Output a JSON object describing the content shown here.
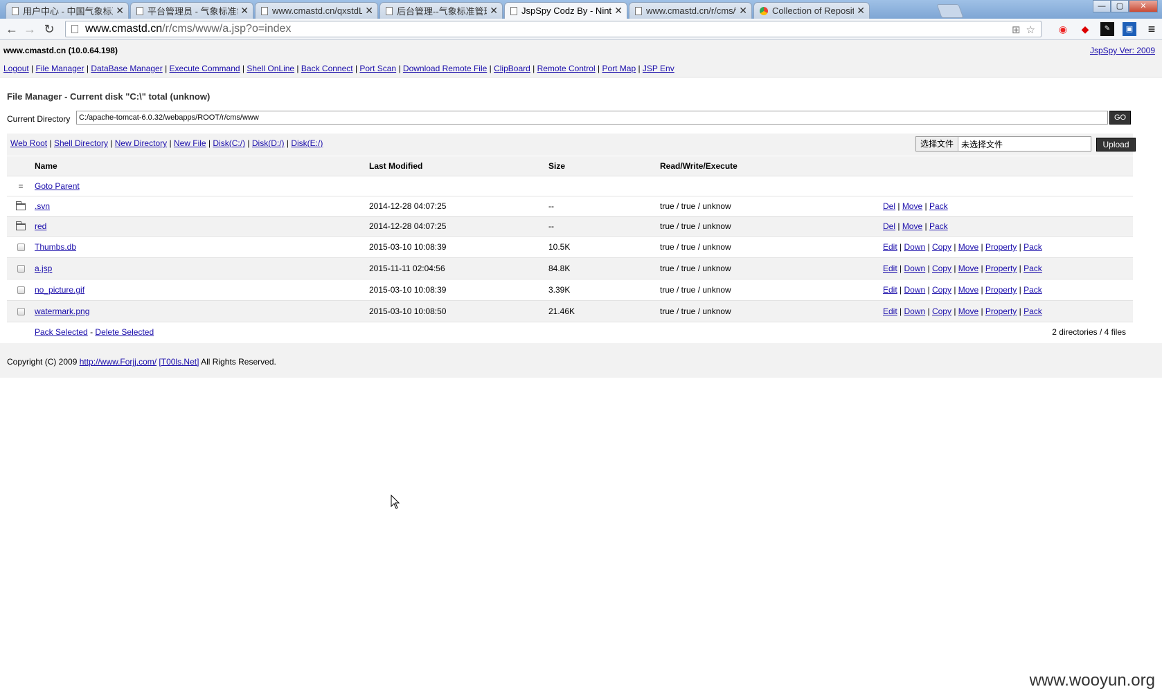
{
  "browser": {
    "tabs": [
      {
        "title": "用户中心 - 中国气象标准",
        "favicon": "doc-icon",
        "active": false
      },
      {
        "title": "平台管理员 - 气象标准制",
        "favicon": "doc-icon",
        "active": false
      },
      {
        "title": "www.cmastd.cn/qxstdLc",
        "favicon": "doc-icon",
        "active": false
      },
      {
        "title": "后台管理--气象标准管理",
        "favicon": "doc-icon",
        "active": false
      },
      {
        "title": "JspSpy Codz By - Ninty",
        "favicon": "doc-icon",
        "active": true
      },
      {
        "title": "www.cmastd.cn/r/cms/w",
        "favicon": "doc-icon",
        "active": false
      },
      {
        "title": "Collection of Repositori",
        "favicon": "globe-icon",
        "active": false
      }
    ],
    "url_host": "www.cmastd.cn",
    "url_path": "/r/cms/www/a.jsp?o=index"
  },
  "header": {
    "host": "www.cmastd.cn (10.0.64.198)",
    "version_link": "JspSpy Ver: 2009"
  },
  "menu": [
    "Logout",
    "File Manager",
    "DataBase Manager",
    "Execute Command",
    "Shell OnLine",
    "Back Connect",
    "Port Scan",
    "Download Remote File",
    "ClipBoard",
    "Remote Control",
    "Port Map",
    "JSP Env"
  ],
  "file_manager": {
    "title": "File Manager - Current disk \"C:\\\" total (unknow)",
    "current_dir_label": "Current Directory",
    "current_dir_value": "C:/apache-tomcat-6.0.32/webapps/ROOT/r/cms/www",
    "go_label": "GO",
    "tool_links": [
      "Web Root",
      "Shell Directory",
      "New Directory",
      "New File",
      "Disk(C:/)",
      "Disk(D:/)",
      "Disk(E:/)"
    ],
    "choose_file_label": "选择文件",
    "no_file_label": "未选择文件",
    "upload_label": "Upload",
    "columns": {
      "name": "Name",
      "modified": "Last Modified",
      "size": "Size",
      "rwx": "Read/Write/Execute"
    },
    "parent_icon": "=",
    "goto_parent": "Goto Parent",
    "rows": [
      {
        "type": "dir",
        "name": ".svn",
        "modified": "2014-12-28 04:07:25",
        "size": "--",
        "rwx": "true / true / unknow",
        "actions": [
          "Del",
          "Move",
          "Pack"
        ]
      },
      {
        "type": "dir",
        "name": "red",
        "modified": "2014-12-28 04:07:25",
        "size": "--",
        "rwx": "true / true / unknow",
        "actions": [
          "Del",
          "Move",
          "Pack"
        ]
      },
      {
        "type": "file",
        "name": "Thumbs.db",
        "modified": "2015-03-10 10:08:39",
        "size": "10.5K",
        "rwx": "true / true / unknow",
        "actions": [
          "Edit",
          "Down",
          "Copy",
          "Move",
          "Property",
          "Pack"
        ]
      },
      {
        "type": "file",
        "name": "a.jsp",
        "modified": "2015-11-11 02:04:56",
        "size": "84.8K",
        "rwx": "true / true / unknow",
        "actions": [
          "Edit",
          "Down",
          "Copy",
          "Move",
          "Property",
          "Pack"
        ]
      },
      {
        "type": "file",
        "name": "no_picture.gif",
        "modified": "2015-03-10 10:08:39",
        "size": "3.39K",
        "rwx": "true / true / unknow",
        "actions": [
          "Edit",
          "Down",
          "Copy",
          "Move",
          "Property",
          "Pack"
        ]
      },
      {
        "type": "file",
        "name": "watermark.png",
        "modified": "2015-03-10 10:08:50",
        "size": "21.46K",
        "rwx": "true / true / unknow",
        "actions": [
          "Edit",
          "Down",
          "Copy",
          "Move",
          "Property",
          "Pack"
        ]
      }
    ],
    "pack_selected": "Pack Selected",
    "footer_dash": "-",
    "delete_selected": "Delete Selected",
    "summary": "2 directories / 4 files"
  },
  "footer": {
    "prefix": "Copyright (C) 2009 ",
    "link1": "http://www.Forjj.com/",
    "link2": "[T00ls.Net]",
    "suffix": " All Rights Reserved."
  },
  "watermark": "www.wooyun.org"
}
